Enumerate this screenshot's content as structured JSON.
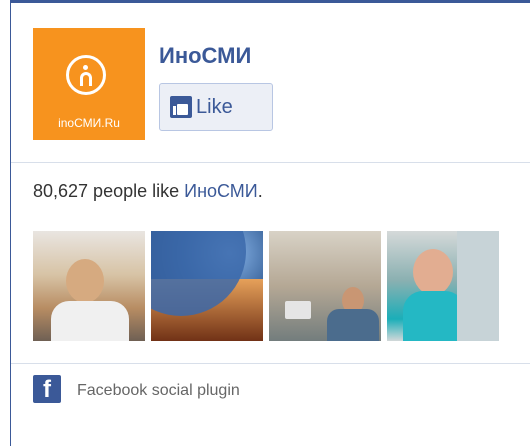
{
  "page": {
    "name": "ИноСМИ",
    "logo_text": "inoСМИ.Ru",
    "logo_glyph": "n"
  },
  "like_button": {
    "label": "Like"
  },
  "stats": {
    "count_text": "80,627 people like ",
    "page_link": "ИноСМИ",
    "suffix": "."
  },
  "faces": [
    {
      "name": "user-1"
    },
    {
      "name": "user-2"
    },
    {
      "name": "user-3"
    },
    {
      "name": "user-4"
    }
  ],
  "footer": {
    "icon_glyph": "f",
    "label": "Facebook social plugin"
  },
  "colors": {
    "brand": "#3b5998",
    "logo_bg": "#f7931e"
  }
}
